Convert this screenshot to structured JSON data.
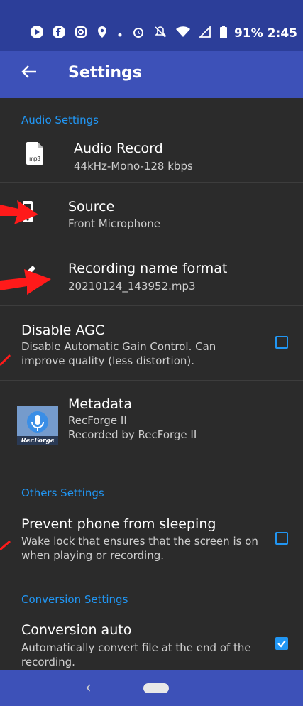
{
  "status_bar": {
    "battery": "91%",
    "time": "2:45",
    "icons": [
      "play-icon",
      "facebook-icon",
      "instagram-icon",
      "location-icon",
      "dot-icon",
      "alarm-icon",
      "mute-icon",
      "wifi-icon",
      "signal-icon",
      "battery-icon"
    ]
  },
  "app_bar": {
    "back_icon": "arrow-left-icon",
    "title": "Settings"
  },
  "sections": {
    "audio": "Audio Settings",
    "others": "Others Settings",
    "conversion": "Conversion Settings"
  },
  "items": {
    "audio_record": {
      "title": "Audio Record",
      "subtitle": "44kHz-Mono-128 kbps",
      "icon": "mp3-file-icon"
    },
    "source": {
      "title": "Source",
      "subtitle": "Front Microphone",
      "icon": "phone-icon"
    },
    "name_format": {
      "title": "Recording name format",
      "subtitle": "20210124_143952.mp3",
      "icon": "pencil-icon"
    },
    "disable_agc": {
      "title": "Disable AGC",
      "subtitle": "Disable Automatic Gain Control. Can improve quality (less distortion).",
      "checked": false
    },
    "metadata": {
      "title": "Metadata",
      "subtitle1": "RecForge II",
      "subtitle2": "Recorded by RecForge II",
      "icon": "recforge-logo-icon",
      "logo_text": "RecForge"
    },
    "prevent_sleep": {
      "title": "Prevent phone from sleeping",
      "subtitle": "Wake lock that ensures that the screen is on when playing or recording.",
      "checked": false
    },
    "conversion_auto": {
      "title": "Conversion auto",
      "subtitle": "Automatically convert file at the end of the recording.",
      "checked": true
    }
  },
  "nav_bar": {
    "back_icon": "chevron-left-icon",
    "home_icon": "home-pill-icon"
  },
  "colors": {
    "status_bar": "#2c3e99",
    "app_bar": "#3d51b8",
    "accent": "#2196f3",
    "background": "#2b2b2b",
    "annotation_arrow": "#ff1a1a"
  }
}
